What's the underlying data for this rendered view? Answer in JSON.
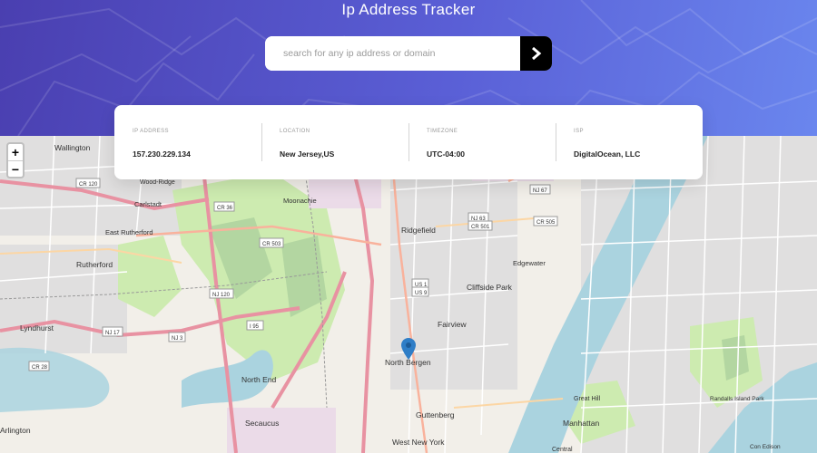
{
  "header": {
    "title": "Ip Address Tracker",
    "gradient_from": "#4a3fb0",
    "gradient_to": "#6a86ee"
  },
  "search": {
    "placeholder": "search for any ip address or domain",
    "value": "",
    "button_icon": "chevron-right-icon"
  },
  "info": [
    {
      "label": "IP ADDRESS",
      "value": "157.230.229.134"
    },
    {
      "label": "LOCATION",
      "value": "New Jersey,US"
    },
    {
      "label": "TIMEZONE",
      "value": "UTC-04:00"
    },
    {
      "label": "ISP",
      "value": "DigitalOcean, LLC"
    }
  ],
  "map": {
    "zoom_in": "+",
    "zoom_out": "−",
    "marker_icon": "map-pin-icon",
    "places": {
      "wallington": "Wallington",
      "wood_ridge": "Wood-Ridge",
      "carlstadt": "Carlstadt",
      "moonachie": "Moonachie",
      "east_rutherford": "East Rutherford",
      "rutherford": "Rutherford",
      "lyndhurst": "Lyndhurst",
      "north_end": "North End",
      "secaucus": "Secaucus",
      "arlington": "Arlington",
      "ridgefield": "Ridgefield",
      "edgewater": "Edgewater",
      "cliffside_park": "Cliffside Park",
      "fairview": "Fairview",
      "north_bergen": "North Bergen",
      "guttenberg": "Guttenberg",
      "west_new_york": "West New York",
      "manhattan": "Manhattan",
      "great_hill": "Great Hill",
      "central": "Central",
      "con_edison": "Con Edison",
      "randalls_island": "Randalls Island Park"
    },
    "shields": {
      "cr120": "CR 120",
      "cr36": "CR 36",
      "cr503": "CR 503",
      "nj120": "NJ 120",
      "i95": "I 95",
      "nj17": "NJ 17",
      "nj3": "NJ 3",
      "cr28": "CR 28",
      "nj63": "NJ 63",
      "cr501": "CR 501",
      "cr505": "CR 505",
      "nj67": "NJ 67",
      "us1": "US 1",
      "us9": "US 9"
    }
  }
}
